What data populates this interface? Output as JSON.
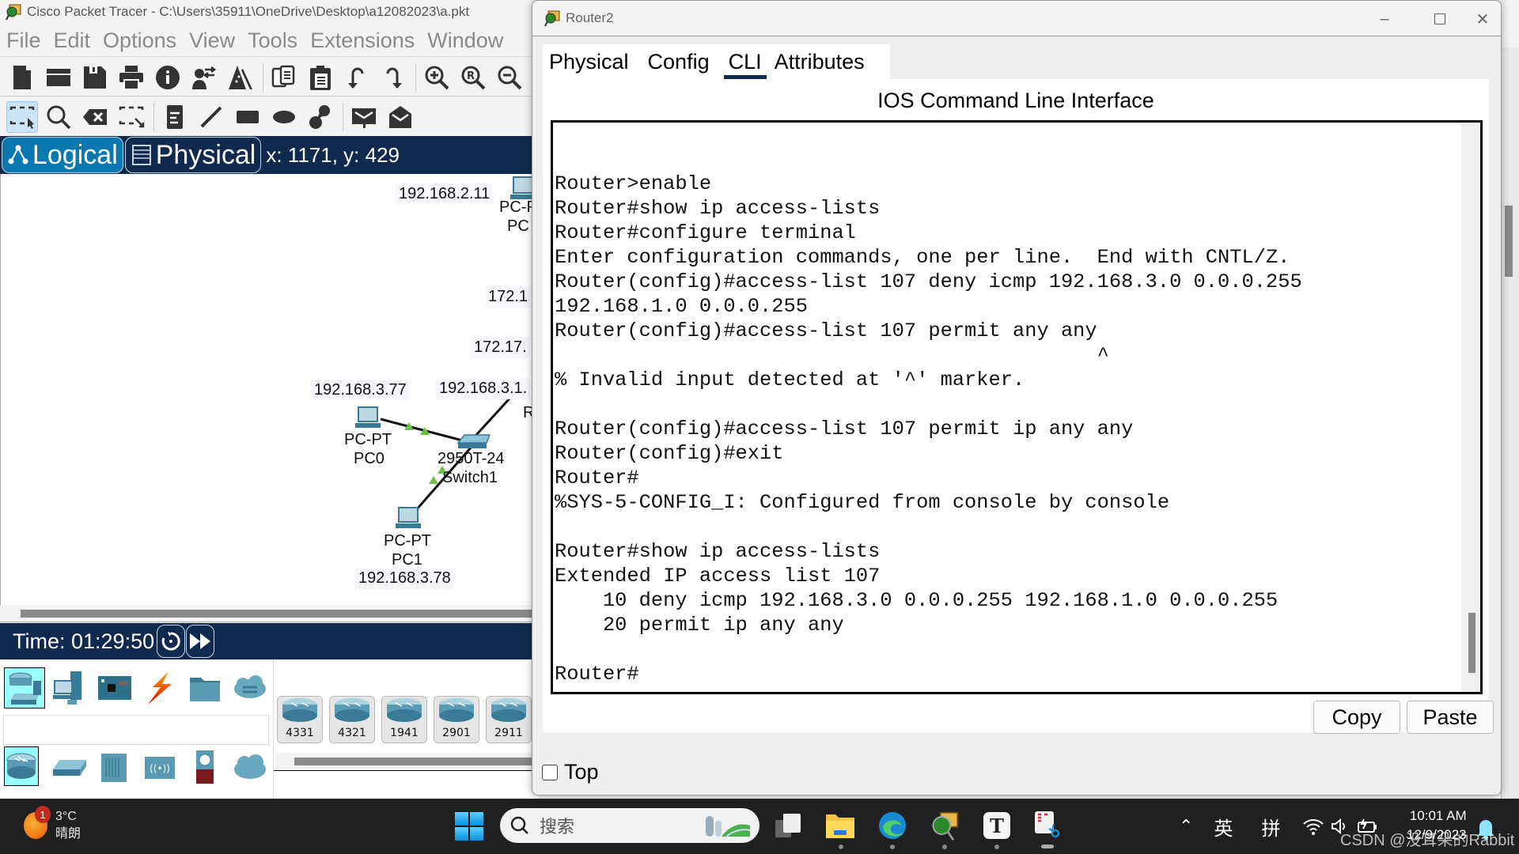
{
  "main_window": {
    "title": "Cisco Packet Tracer - C:\\Users\\35911\\OneDrive\\Desktop\\a12082023\\a.pkt",
    "menu": [
      "File",
      "Edit",
      "Options",
      "View",
      "Tools",
      "Extensions",
      "Window"
    ],
    "toolbar1_icons": [
      "new-file-icon",
      "open-folder-icon",
      "save-icon",
      "print-icon",
      "info-icon",
      "activity-wizard-icon",
      "custom-pdu-icon",
      "copy-icon",
      "paste-icon",
      "undo-icon",
      "redo-icon",
      "zoom-in-icon",
      "zoom-reset-icon",
      "zoom-out-icon"
    ],
    "toolbar2_icons": [
      "select-icon",
      "inspect-icon",
      "delete-icon",
      "resize-shape-icon",
      "place-note-icon",
      "draw-line-icon",
      "draw-rectangle-icon",
      "draw-ellipse-icon",
      "draw-freeform-icon",
      "simple-pdu-icon",
      "complex-pdu-icon"
    ],
    "mode_tabs": [
      {
        "label": "Logical",
        "active": true
      },
      {
        "label": "Physical",
        "active": false
      }
    ],
    "coordinates": "x: 1171, y: 429",
    "time": "Time: 01:29:50",
    "canvas": {
      "ip_labels": [
        "192.168.2.11",
        "172.1",
        "172.17.",
        "192.168.3.77",
        "192.168.3.1."
      ],
      "devices": [
        {
          "type": "PC-PT",
          "name": "PC0",
          "ip": "192.168.3.77"
        },
        {
          "type": "PC-PT",
          "name": "PC1",
          "ip": "192.168.3.78"
        },
        {
          "type": "2950T-24",
          "name": "Switch1"
        },
        {
          "type": "PC-P",
          "name": "PC"
        },
        {
          "type": "",
          "name": "R"
        }
      ],
      "link_color": "#6cc04a"
    },
    "device_categories_top": [
      "network-devices-icon",
      "end-devices-icon",
      "components-icon",
      "connections-icon",
      "miscellaneous-icon",
      "multiuser-icon"
    ],
    "device_categories_bottom": [
      "routers-icon",
      "switches-icon",
      "hubs-icon",
      "wireless-icon",
      "security-icon",
      "wan-emulation-icon"
    ],
    "router_models": [
      "4331",
      "4321",
      "1941",
      "2901",
      "2911"
    ]
  },
  "router_window": {
    "title": "Router2",
    "tabs": [
      {
        "label": "Physical",
        "active": false
      },
      {
        "label": "Config",
        "active": false
      },
      {
        "label": "CLI",
        "active": true
      },
      {
        "label": "Attributes",
        "active": false
      }
    ],
    "heading": "IOS Command Line Interface",
    "cli_lines": [
      "",
      "",
      "Router>enable",
      "Router#show ip access-lists",
      "Router#configure terminal",
      "Enter configuration commands, one per line.  End with CNTL/Z.",
      "Router(config)#access-list 107 deny icmp 192.168.3.0 0.0.0.255",
      "192.168.1.0 0.0.0.255",
      "Router(config)#access-list 107 permit any any",
      "                                             ^",
      "% Invalid input detected at '^' marker.",
      "",
      "Router(config)#access-list 107 permit ip any any",
      "Router(config)#exit",
      "Router#",
      "%SYS-5-CONFIG_I: Configured from console by console",
      "",
      "Router#show ip access-lists",
      "Extended IP access list 107",
      "    10 deny icmp 192.168.3.0 0.0.0.255 192.168.1.0 0.0.0.255",
      "    20 permit ip any any",
      "",
      "Router#"
    ],
    "copy_label": "Copy",
    "paste_label": "Paste",
    "top_label": "Top",
    "top_checked": false,
    "accent": "#0f2a4d"
  },
  "taskbar": {
    "weather_temp": "3°C",
    "weather_desc": "晴朗",
    "weather_badge": "1",
    "search_placeholder": "搜索",
    "apps": [
      "task-view-icon",
      "file-explorer-icon",
      "edge-icon",
      "packet-tracer-icon",
      "typora-icon",
      "snipping-tool-icon"
    ],
    "ime_lang": "英",
    "ime_mode": "拼",
    "time": "10:01 AM",
    "date": "12/9/2023"
  },
  "watermark": "CSDN @没耳朵的Rabbit"
}
